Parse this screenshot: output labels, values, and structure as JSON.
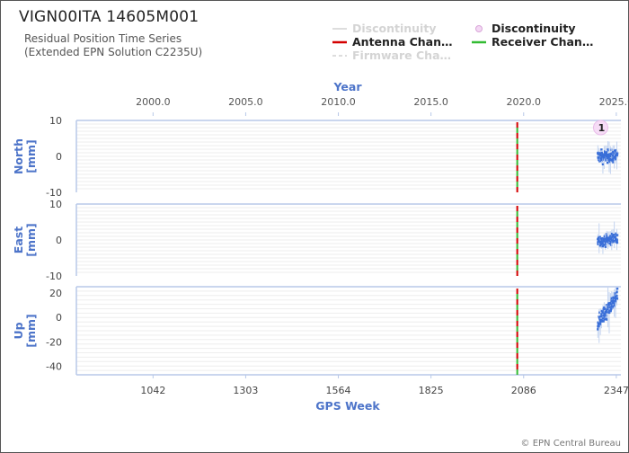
{
  "header": {
    "title": "VIGN00ITA 14605M001",
    "subtitle_line1": "Residual Position Time Series",
    "subtitle_line2": "(Extended EPN Solution C2235U)"
  },
  "legend": [
    {
      "label": "Discontinuity",
      "state": "hidden",
      "color": "#cccccc",
      "symbol": "line"
    },
    {
      "label": "Discontinuity",
      "state": "visible",
      "color": "#d06bd0",
      "symbol": "circle"
    },
    {
      "label": "Antenna Chan…",
      "state": "visible",
      "color": "#d40000",
      "symbol": "line"
    },
    {
      "label": "Receiver Chan…",
      "state": "visible",
      "color": "#33bb33",
      "symbol": "line"
    },
    {
      "label": "Firmware Cha…",
      "state": "hidden",
      "color": "#cccccc",
      "symbol": "dashed-line"
    }
  ],
  "footer": {
    "credit": "© EPN Central Bureau"
  },
  "chart_data": {
    "type": "scatter",
    "top_axis": {
      "title": "Year",
      "ticks": [
        "2000.0",
        "2005.0",
        "2010.0",
        "2015.0",
        "2020.0",
        "2025.0"
      ]
    },
    "bottom_axis": {
      "title": "GPS Week",
      "ticks": [
        "1042",
        "1303",
        "1564",
        "1825",
        "2086",
        "2347"
      ],
      "range": [
        826,
        2360
      ]
    },
    "year_ticks_week": [
      1042,
      1303,
      1564,
      1825,
      2086,
      2347
    ],
    "panels": [
      {
        "name": "North",
        "ylabel": "North\n[mm]",
        "ylim": [
          -10,
          10
        ],
        "ticks": [
          10,
          0,
          -10
        ],
        "data_start_week": 2295,
        "data_end_week": 2350,
        "trend": [
          0,
          0
        ],
        "noise": 1.2
      },
      {
        "name": "East",
        "ylabel": "East\n[mm]",
        "ylim": [
          -10,
          10
        ],
        "ticks": [
          10,
          0,
          -10
        ],
        "data_start_week": 2295,
        "data_end_week": 2350,
        "trend": [
          -0.5,
          0.5
        ],
        "noise": 1.0
      },
      {
        "name": "Up",
        "ylabel": "Up\n[mm]",
        "ylim": [
          -47,
          25
        ],
        "ticks": [
          20,
          0,
          -20,
          -40
        ],
        "data_start_week": 2295,
        "data_end_week": 2350,
        "trend": [
          -5,
          17
        ],
        "noise": 4
      }
    ],
    "equipment_changes": [
      {
        "type": "Antenna",
        "week": 2068,
        "color": "#d40000"
      },
      {
        "type": "Receiver",
        "week": 2068,
        "color": "#33bb33"
      }
    ],
    "discontinuities": [
      {
        "label": "1",
        "week": 2303,
        "panel": "North",
        "y": 8
      }
    ],
    "series_color": "#3a6fd8",
    "grid": true
  }
}
